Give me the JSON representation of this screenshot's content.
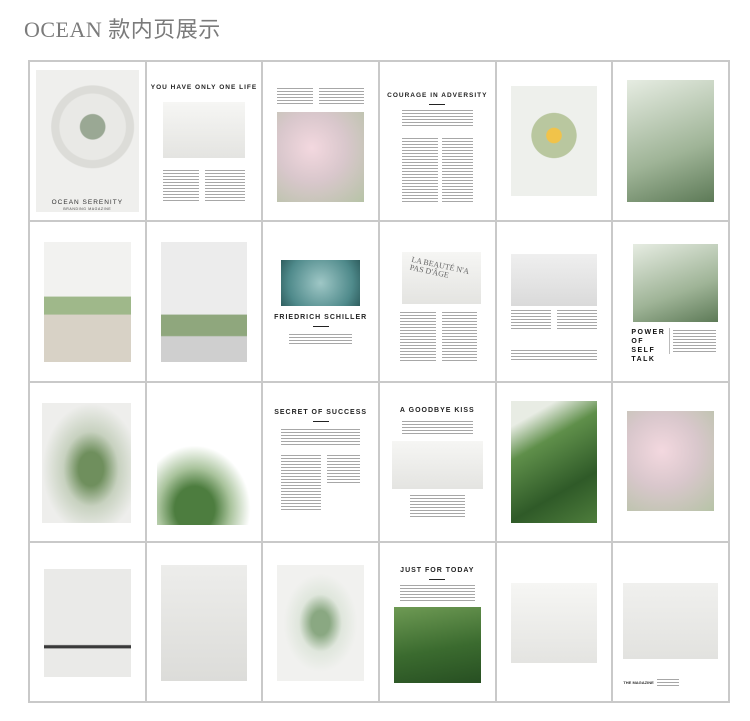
{
  "header": {
    "title": "OCEAN 款内页展示"
  },
  "pages": {
    "ocean_serenity": {
      "title": "OCEAN SERENITY",
      "subtitle": "BRANDING MAGAZINE"
    },
    "one_life": {
      "title": "YOU HAVE ONLY ONE LIFE"
    },
    "courage": {
      "title": "COURAGE IN ADVERSITY"
    },
    "schiller": {
      "title": "FRIEDRICH SCHILLER"
    },
    "beaute": {
      "title": "LA BEAUTÉ N'A PAS D'ÂGE"
    },
    "power": {
      "title": "POWER OF SELF TALK"
    },
    "secret": {
      "title": "SECRET OF SUCCESS"
    },
    "goodbye": {
      "title": "A GOODBYE KISS"
    },
    "today": {
      "title": "JUST FOR TODAY"
    },
    "magazine": {
      "title": "THE MAGAZINE"
    }
  }
}
